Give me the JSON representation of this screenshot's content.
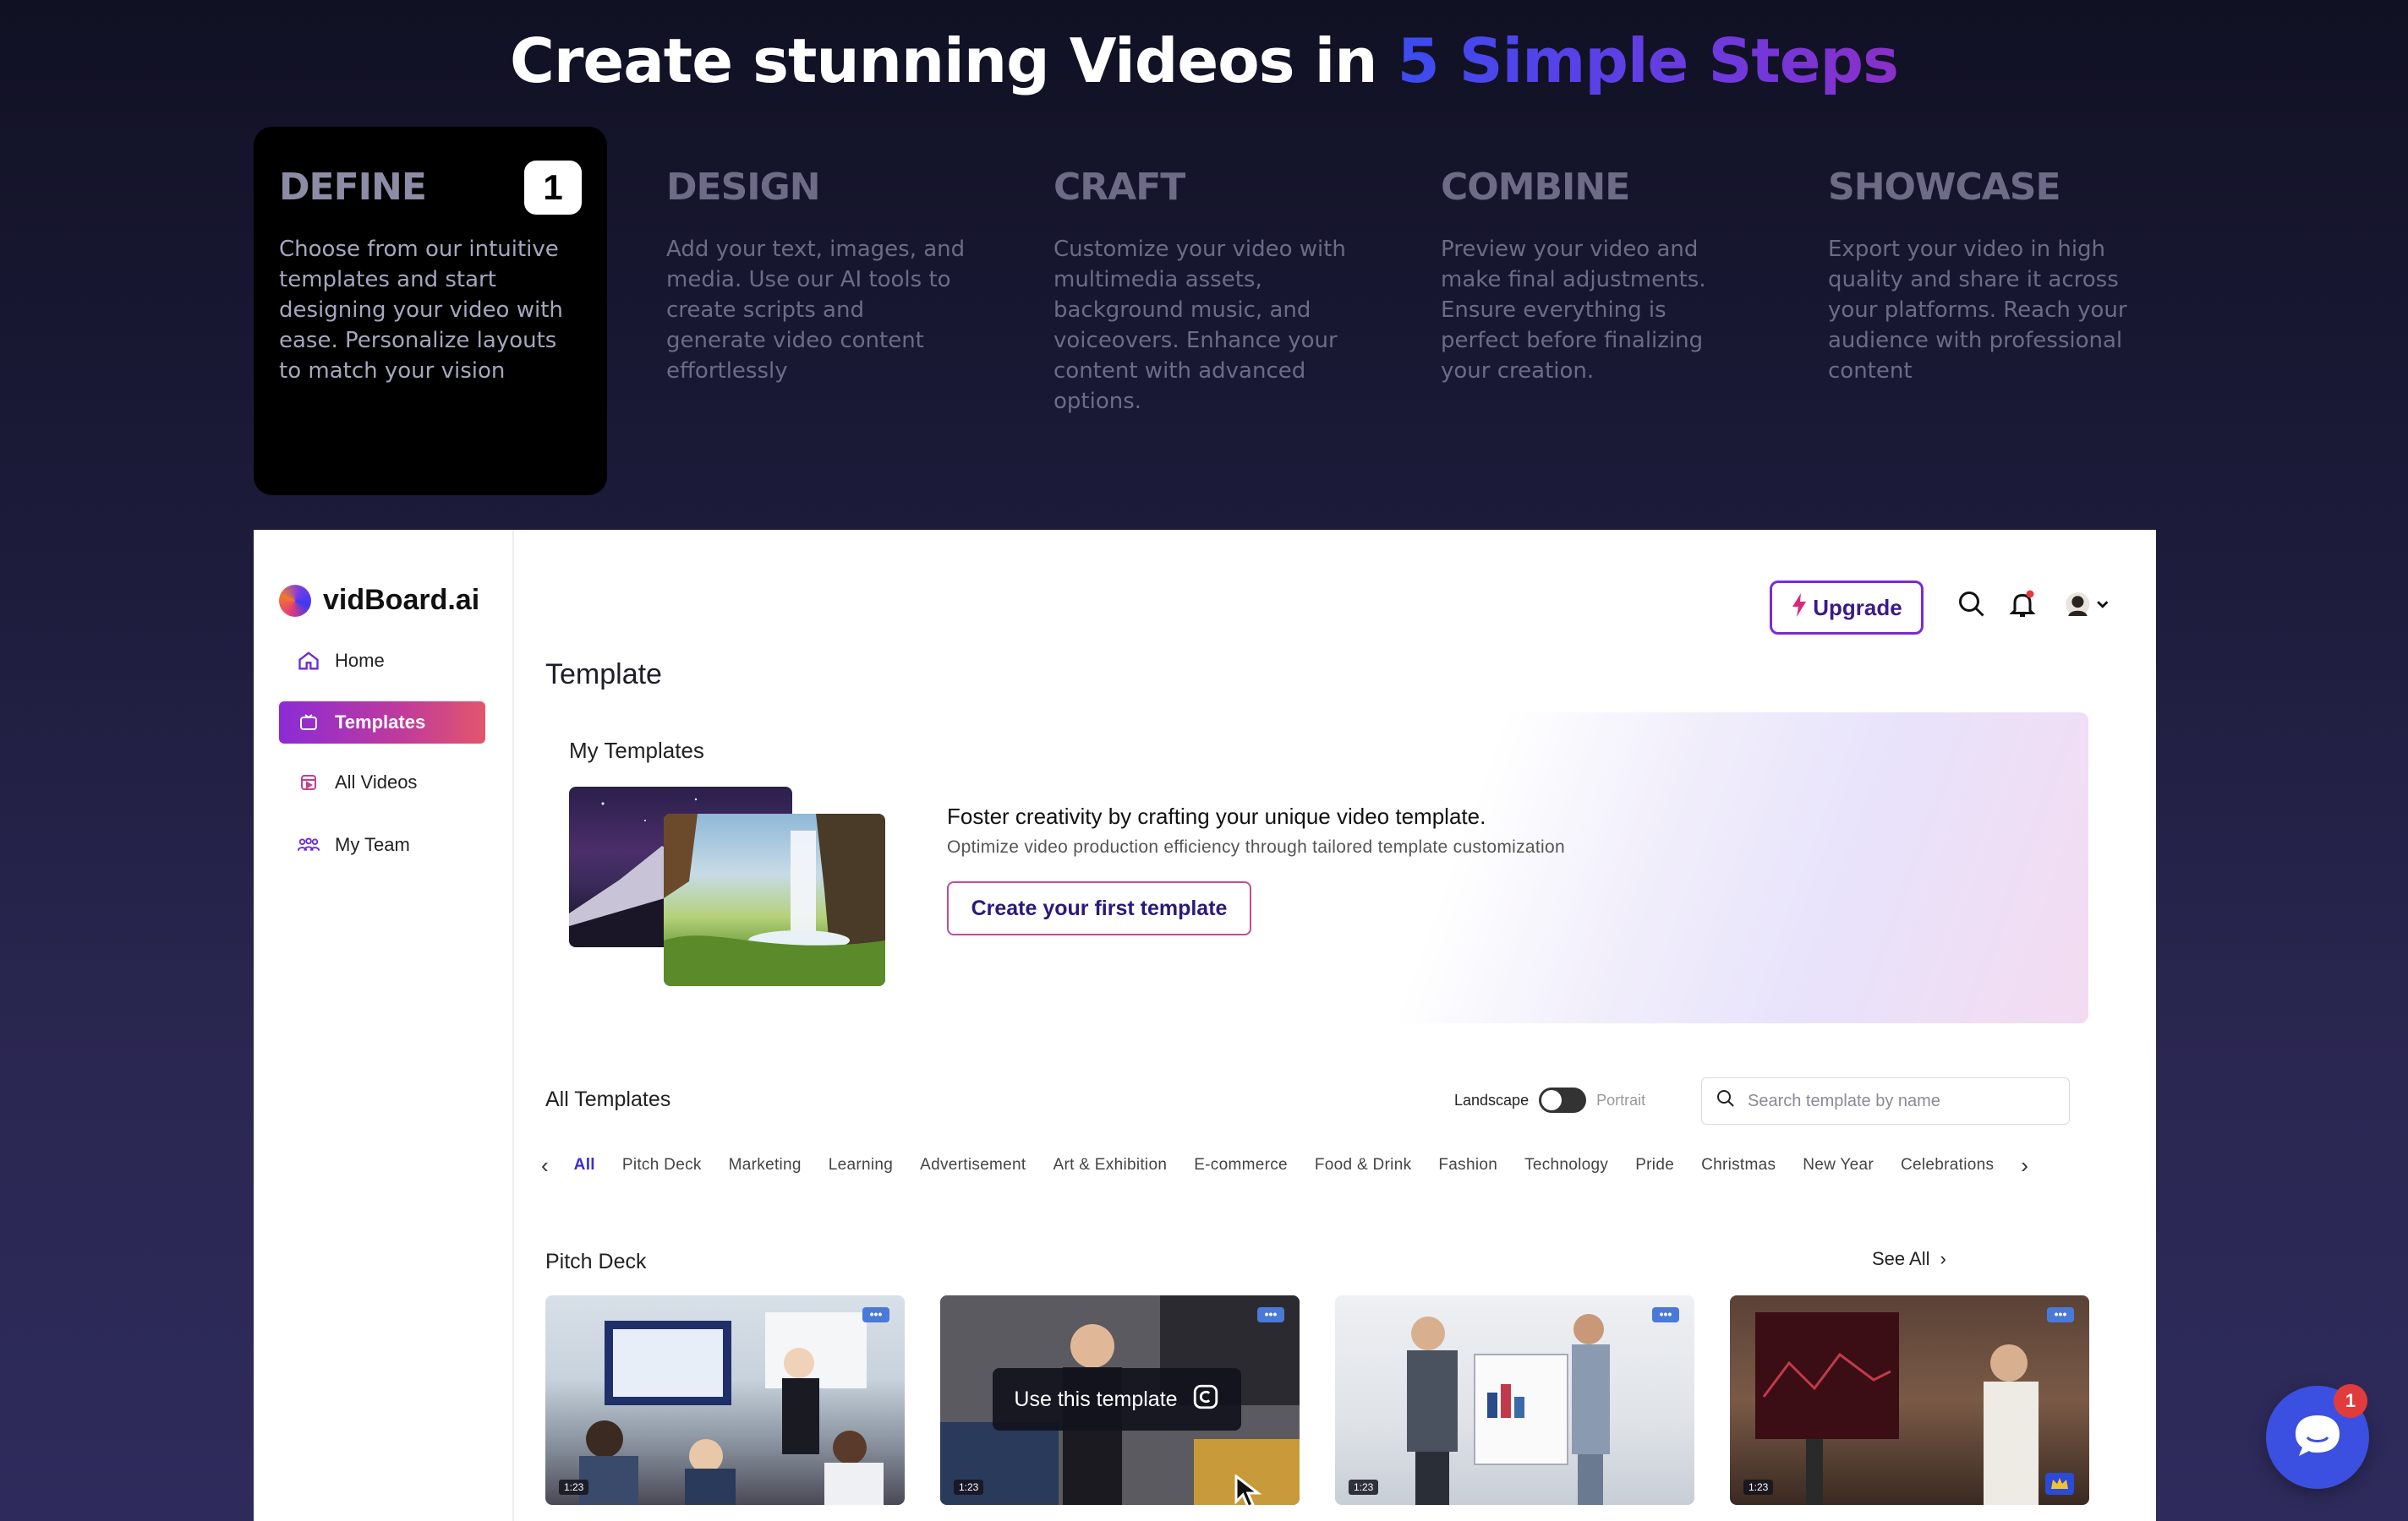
{
  "hero": {
    "title_prefix": "Create stunning Videos in ",
    "title_accent": "5 Simple Steps"
  },
  "steps": [
    {
      "title": "DEFINE",
      "number": "1",
      "active": true,
      "desc": "Choose from our intuitive templates and start designing your video with ease. Personalize layouts to match your vision"
    },
    {
      "title": "DESIGN",
      "desc": "Add your text, images, and media. Use our AI tools to create scripts and generate video content effortlessly"
    },
    {
      "title": "CRAFT",
      "desc": "Customize your video with multimedia assets, background music, and voiceovers. Enhance your content with advanced options."
    },
    {
      "title": "COMBINE",
      "desc": "Preview your video and make final adjustments. Ensure everything is perfect before finalizing your creation."
    },
    {
      "title": "SHOWCASE",
      "desc": "Export your video in high quality and share it across your platforms. Reach your audience with professional content"
    }
  ],
  "app": {
    "brand": "vidBoard.ai",
    "nav": [
      {
        "label": "Home",
        "icon": "home-icon"
      },
      {
        "label": "Templates",
        "icon": "templates-icon",
        "active": true
      },
      {
        "label": "All Videos",
        "icon": "videos-icon"
      },
      {
        "label": "My Team",
        "icon": "team-icon"
      }
    ],
    "upgrade_label": "Upgrade",
    "page_title": "Template",
    "banner": {
      "label": "My Templates",
      "headline": "Foster creativity by crafting your unique video template.",
      "subline": "Optimize video production efficiency through tailored template customization",
      "button": "Create your first template"
    },
    "all_templates": {
      "title": "All Templates",
      "toggle_left": "Landscape",
      "toggle_right": "Portrait",
      "search_placeholder": "Search template by name",
      "categories": [
        "All",
        "Pitch Deck",
        "Marketing",
        "Learning",
        "Advertisement",
        "Art & Exhibition",
        "E-commerce",
        "Food & Drink",
        "Fashion",
        "Technology",
        "Pride",
        "Christmas",
        "New Year",
        "Celebrations"
      ]
    },
    "pitch_deck": {
      "title": "Pitch Deck",
      "see_all": "See All",
      "use_template": "Use this template",
      "time": "1:23",
      "badge": "•••"
    },
    "chat_unread": "1"
  },
  "colors": {
    "accent_blue": "#3b4cf0",
    "accent_purple": "#8a2fc8",
    "chat": "#3b50e0"
  }
}
